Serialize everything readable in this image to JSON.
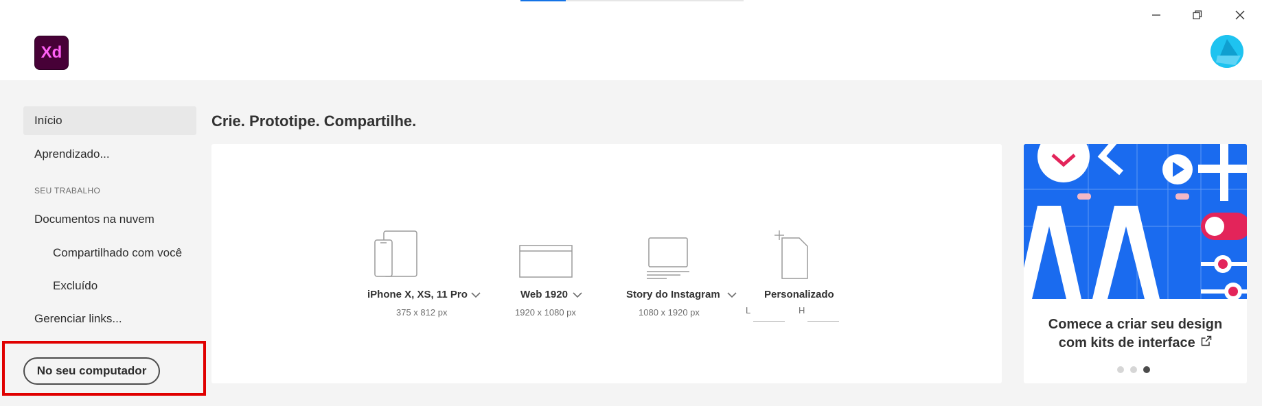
{
  "app": {
    "logo_text": "Xd",
    "brand_color": "#470137",
    "logo_text_color": "#ff61f6",
    "accent": "#1473e6"
  },
  "window_controls": [
    "minimize-icon",
    "restore-icon",
    "close-icon"
  ],
  "sidebar": {
    "items": [
      {
        "label": "Início",
        "active": true
      },
      {
        "label": "Aprendizado..."
      },
      {
        "label": "Documentos na nuvem"
      },
      {
        "label": "Compartilhado com você",
        "sub": true
      },
      {
        "label": "Excluído",
        "sub": true
      },
      {
        "label": "Gerenciar links..."
      }
    ],
    "section_label": "SEU TRABALHO",
    "local_button": "No seu computador"
  },
  "main": {
    "headline": "Crie. Prototipe. Compartilhe.",
    "presets": [
      {
        "name": "iPhone X, XS, 11 Pro",
        "size": "375 x 812 px",
        "icon": "devices-icon"
      },
      {
        "name": "Web 1920",
        "size": "1920 x 1080 px",
        "icon": "browser-icon"
      },
      {
        "name": "Story do Instagram",
        "size": "1080 x 1920 px",
        "icon": "monitor-icon"
      },
      {
        "name": "Personalizado",
        "width_label": "L",
        "height_label": "H",
        "icon": "custom-document-icon"
      }
    ]
  },
  "promo": {
    "line1": "Comece a criar seu design",
    "line2": "com kits de interface",
    "dots": 3,
    "active_dot": 3,
    "art_color": "#1a6bef"
  },
  "annotation": {
    "color": "#e00000"
  }
}
